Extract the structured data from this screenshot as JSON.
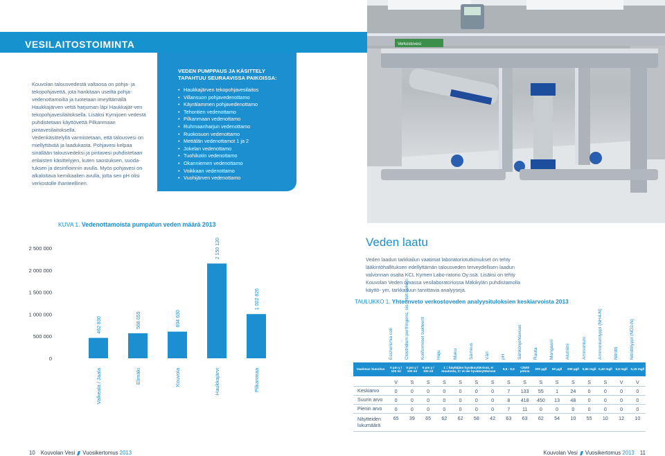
{
  "section": {
    "title": "VESILAITOSTOIMINTA"
  },
  "intro": {
    "p1": "Kouvolan talousvedestä valtaosa on pohja- ja tekopohjavettä, jota hankitaan useilta pohja-vedenottamoilta ja tuotetaan imeyttämällä Haukkajärven vettä harjuman läpi Haukkajär-ven tekopohjavesilaitoksella. Lisäksi Kymijoen vedestä puhdistetaan käyttövettä Pilkanmaan pintavesilaitoksella.",
    "p2": "Vedenkäsittelyllä varmistetaan, että talousvesi on miellyttävää ja laadukasta. Pohjavesi kelpaa sinällään talousvedeksi ja pintavesi puhdistetaan erilaisten käsittelyjen, kuten saostuksen, suoda-tuksen ja desinfioinnin avulla. Myös pohjavesi on alkaloitava kemikaalien avulla, jotta sen pH olisi verkostolle ihanteellinen."
  },
  "callout": {
    "title": "VEDEN PUMPPAUS JA KÄSITTELY TAPAHTUU SEURAAVISSA PAIKOISSA:",
    "items": [
      "Haukkajärven tekopohjavesilaitos",
      "Villansuon pohjavedenottamo",
      "Käyrälammen pohjavedenottamo",
      "Tehontien vedenottamo",
      "Pilkanmaan vedenottamo",
      "Ruhmaanharjun vedenottamo",
      "Ruokosuon vedenottamo",
      "Mettälän vedenottamot 1 ja 2",
      "Jokelan vedenottamo",
      "Tuohikotin vedenottamo",
      "Okanniemen vedenottamo",
      "Voikkaan vedenottamo",
      "Vuohijärven vedenottamo"
    ]
  },
  "photo": {
    "sign_text": "Verkostovesi"
  },
  "figure": {
    "label": "KUVA 1. ",
    "title": "Vedenottamoista pumpatun veden määrä 2013"
  },
  "chart_data": {
    "type": "bar",
    "categories": [
      "Valkeala / Jaala",
      "Elimäki",
      "Kouvola",
      "Haukkajärvi",
      "Pilkanmaa"
    ],
    "values": [
      462830,
      568055,
      604630,
      2150120,
      1002826
    ],
    "data_labels": [
      "462 830",
      "568 055",
      "604 630",
      "2 150 120",
      "1 002 826"
    ],
    "y_ticks": [
      "0",
      "500 000",
      "1 000 000",
      "1 500 000",
      "2 000 000",
      "2 500 000"
    ],
    "ylim": [
      0,
      2500000
    ],
    "grid": false,
    "colors": {
      "bar": "#1b8fd0",
      "label": "#1b8fd0"
    }
  },
  "quality": {
    "title": "Veden laatu",
    "text": "Veden laadun tarkkailun vaatimat laboratoriotutkimukset on tehty lääkintöhallituksen edellyttämän talousveden terveydellisen laadun valvonnan osalta KCL Kymen Labo-ratorio Oy:ssä. Lisäksi on tehty Kouvolan Veden omassa vesilaboratoriossa Mäkikylän puhdistamolla käyttö- ym. tarkkailuun tarvittavia analyyseja."
  },
  "table": {
    "label": "TAULUKKO 1. ",
    "title": "Yhteenveto verkostoveden analyysituloksien keskiarvoista 2013",
    "columns": [
      "Escherichia coli",
      "Clostridium perfringens, sis.. itiöt Lukem",
      "Koliformiset bakteerit",
      "Haju",
      "Maku",
      "Sameus",
      "Väri",
      "pH",
      "Sähkönjohtavuus",
      "Rauta",
      "Mangaani",
      "Alumiini",
      "Ammonium",
      "Ammoniumtyppi (NH4-N)",
      "Nitriitti",
      "Nitriittityppi (NO2-N)"
    ],
    "requirement_label": "Vaatimus Suositus",
    "requirements": [
      "0 pm y / 100 ml",
      "0 pm y / 100 ml",
      "0 pm y / 100 ml",
      "1 = käyttäjien hyväksyttävissä, ei muutosta, 2= ei ole hyväksyttävissä",
      "6,5 - 9,5",
      "<2500 µS/cm",
      "200 µg/l",
      "50 µg/l",
      "200 µg/l",
      "0,50 mg/l",
      "0,40 mg/l",
      "0,5 mg/l",
      "0,15 mg/l"
    ],
    "rows": [
      {
        "label": "",
        "values": [
          "V",
          "S",
          "S",
          "S",
          "S",
          "S",
          "S",
          "S",
          "S",
          "S",
          "S",
          "S",
          "S",
          "S",
          "V",
          "V"
        ]
      },
      {
        "label": "Keskiarvo",
        "values": [
          "0",
          "0",
          "0",
          "0",
          "0",
          "0",
          "0",
          "7",
          "133",
          "55",
          "1",
          "24",
          "0",
          "0",
          "0",
          "0"
        ]
      },
      {
        "label": "Suurin arvo",
        "values": [
          "0",
          "0",
          "0",
          "0",
          "0",
          "0",
          "0",
          "8",
          "418",
          "450",
          "13",
          "48",
          "0",
          "0",
          "0",
          "0"
        ]
      },
      {
        "label": "Pienin arvo",
        "values": [
          "0",
          "0",
          "0",
          "0",
          "0",
          "0",
          "0",
          "7",
          "11",
          "0",
          "0",
          "0",
          "0",
          "0",
          "0",
          "0"
        ]
      },
      {
        "label": "Näytteiden lukumäärä",
        "values": [
          "65",
          "39",
          "65",
          "62",
          "62",
          "58",
          "42",
          "63",
          "63",
          "62",
          "54",
          "10",
          "55",
          "10",
          "12",
          "10"
        ]
      }
    ]
  },
  "footer": {
    "left_page": "10",
    "right_page": "11",
    "org": "Kouvolan Vesi",
    "report": "Vuosikertomus",
    "year": "2013"
  }
}
